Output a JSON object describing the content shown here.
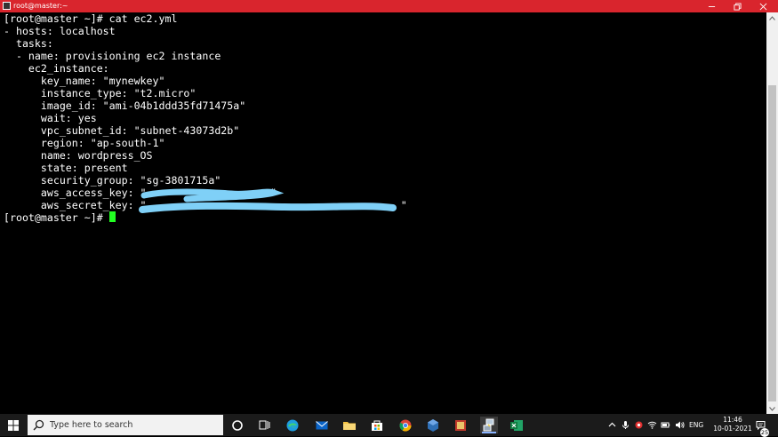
{
  "window": {
    "title": "root@master:~"
  },
  "terminal": {
    "lines": [
      "[root@master ~]# cat ec2.yml",
      "- hosts: localhost",
      "  tasks:",
      "  - name: provisioning ec2 instance",
      "    ec2_instance:",
      "      key_name: \"mynewkey\"",
      "      instance_type: \"t2.micro\"",
      "      image_id: \"ami-04b1ddd35fd71475a\"",
      "      wait: yes",
      "      vpc_subnet_id: \"subnet-43073d2b\"",
      "      region: \"ap-south-1\"",
      "      name: wordpress_OS",
      "      state: present",
      "      security_group: \"sg-3801715a\"",
      "      aws_access_key: \"                    \"",
      "      aws_secret_key: \"                                         \"",
      "[root@master ~]# "
    ],
    "redaction_color": "#7fd0f7",
    "cursor_color": "#22ff22"
  },
  "taskbar": {
    "search_placeholder": "Type here to search",
    "apps": [
      "task-view-icon",
      "edge-icon",
      "mail-icon",
      "file-explorer-icon",
      "store-icon",
      "chrome-icon",
      "virtualbox-icon",
      "app-icon",
      "putty-icon",
      "excel-icon"
    ],
    "language": "ENG",
    "time": "11:46",
    "date": "10-01-2021",
    "notification_count": "25"
  },
  "colors": {
    "titlebar": "#d9252d",
    "terminal_bg": "#000000",
    "taskbar_bg": "#1b1b1b"
  }
}
